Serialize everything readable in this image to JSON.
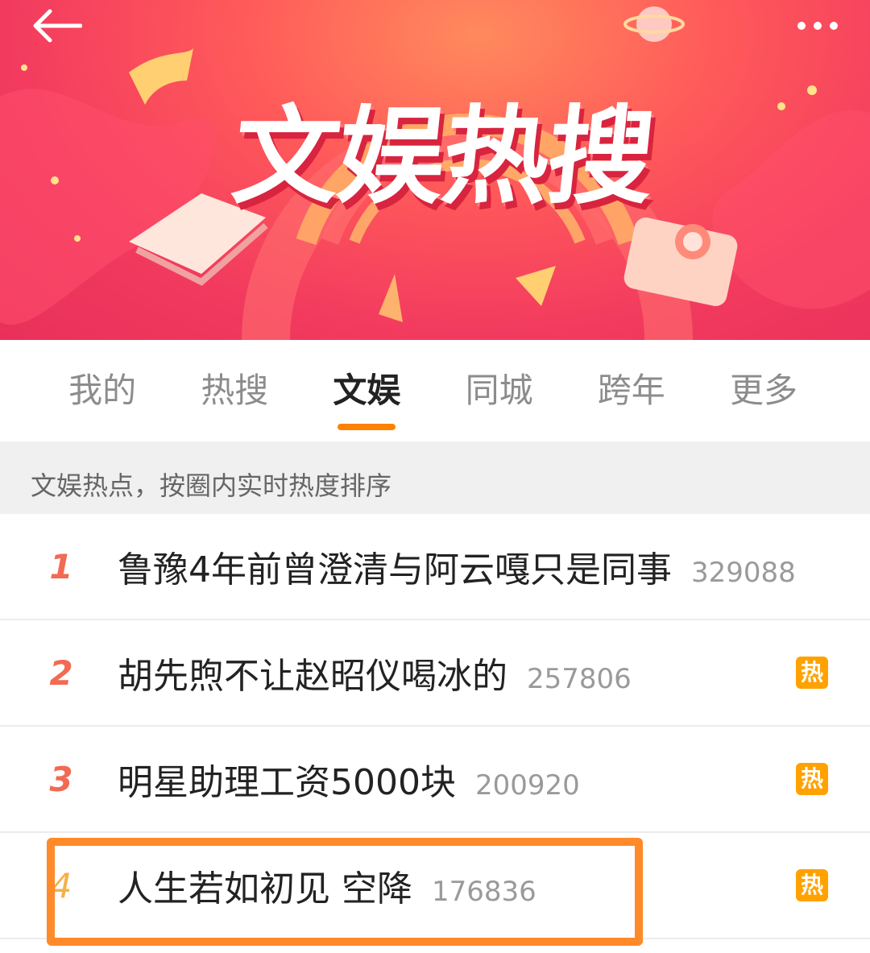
{
  "banner": {
    "title": "文娱热搜",
    "back_icon": "arrow-left-icon",
    "more_icon": "more-dots-icon"
  },
  "tabs": [
    {
      "label": "我的",
      "active": false
    },
    {
      "label": "热搜",
      "active": false
    },
    {
      "label": "文娱",
      "active": true
    },
    {
      "label": "同城",
      "active": false
    },
    {
      "label": "跨年",
      "active": false
    },
    {
      "label": "更多",
      "active": false
    }
  ],
  "subheader": "文娱热点，按圈内实时热度排序",
  "items": [
    {
      "rank": "1",
      "title": "鲁豫4年前曾澄清与阿云嘎只是同事",
      "count": "329088",
      "badge": ""
    },
    {
      "rank": "2",
      "title": "胡先煦不让赵昭仪喝冰的",
      "count": "257806",
      "badge": "热"
    },
    {
      "rank": "3",
      "title": "明星助理工资5000块",
      "count": "200920",
      "badge": "热"
    },
    {
      "rank": "4",
      "title": "人生若如初见 空降",
      "count": "176836",
      "badge": "热"
    }
  ],
  "colors": {
    "accent": "#ff8200",
    "rank": "#f26a53",
    "hot_badge": "#ffa200",
    "highlight": "#ff8a2a"
  }
}
